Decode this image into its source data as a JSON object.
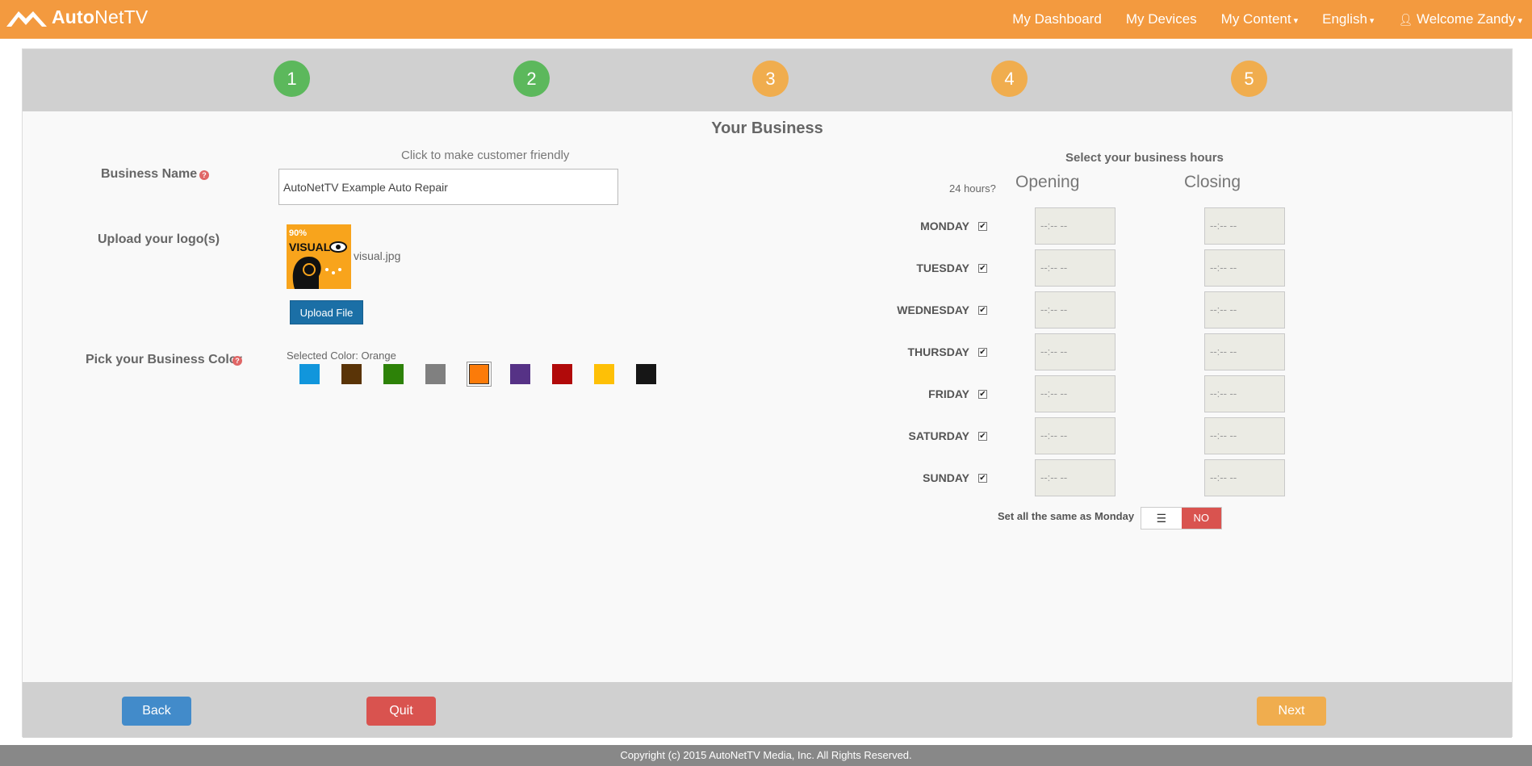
{
  "app": {
    "brand_bold": "Auto",
    "brand_light": "NetTV"
  },
  "nav": {
    "dashboard": "My Dashboard",
    "devices": "My Devices",
    "content": "My Content",
    "language": "English",
    "user": "Welcome Zandy"
  },
  "steps": [
    {
      "num": "1",
      "status": "done"
    },
    {
      "num": "2",
      "status": "done"
    },
    {
      "num": "3",
      "status": "pending"
    },
    {
      "num": "4",
      "status": "pending"
    },
    {
      "num": "5",
      "status": "pending"
    }
  ],
  "section_title": "Your Business",
  "business": {
    "name_label": "Business Name",
    "hint": "Click to make customer friendly",
    "name_value": "AutoNetTV Example Auto Repair",
    "logo_label": "Upload your logo(s)",
    "logo_file": "visual.jpg",
    "logo_art_text": "VISUAL",
    "logo_art_percent": "90%",
    "upload_button": "Upload File",
    "color_label": "Pick your Business Color",
    "selected_color": "Selected Color: Orange",
    "colors": [
      "#1196dc",
      "#5a3407",
      "#2d8208",
      "#808080",
      "#fc7b09",
      "#563286",
      "#b10a0a",
      "#fec006",
      "#161616"
    ],
    "selected_index": 4
  },
  "hours": {
    "title": "Select your business hours",
    "hours24_label": "24 hours?",
    "opening_label": "Opening",
    "closing_label": "Closing",
    "placeholder": "--:-- --",
    "days": [
      "MONDAY",
      "TUESDAY",
      "WEDNESDAY",
      "THURSDAY",
      "FRIDAY",
      "SATURDAY",
      "SUNDAY"
    ],
    "all_24_checked": true,
    "same_label": "Set all the same as Monday",
    "toggle_value": "NO"
  },
  "buttons": {
    "back": "Back",
    "quit": "Quit",
    "next": "Next"
  },
  "footer": "Copyright (c) 2015 AutoNetTV Media, Inc. All Rights Reserved.",
  "colors": {
    "accent": "#f39a3f",
    "done": "#5cb85c",
    "pending": "#f0ad4e"
  }
}
